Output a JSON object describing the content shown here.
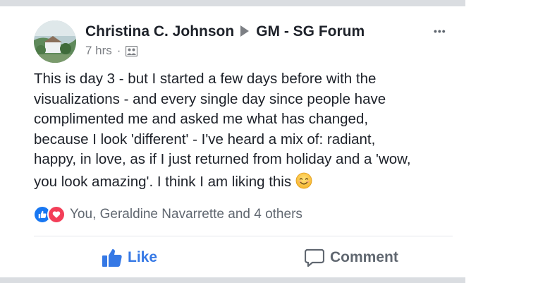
{
  "post": {
    "author": "Christina C. Johnson",
    "group": "GM - SG Forum",
    "time": "7 hrs",
    "visibility_icon": "group-icon",
    "more_label": "•••",
    "text_lines": [
      "This is day 3 - but I started a few days before with the",
      "visualizations - and every single day since people have",
      "complimented me and asked me what has changed,",
      "because I look 'different' - I've heard a mix of: radiant,",
      "happy, in love, as if I just returned from holiday and a 'wow,",
      "you look amazing'. I think I am liking this"
    ],
    "emoji": "smiling-face-icon"
  },
  "reactions": {
    "types": [
      "like-reaction-icon",
      "love-reaction-icon"
    ],
    "summary": "You, Geraldine Navarrette and 4 others"
  },
  "actions": {
    "like_label": "Like",
    "comment_label": "Comment"
  },
  "colors": {
    "like_blue": "#3578e5",
    "love_red": "#f33e58",
    "text_dark": "#1d2129",
    "text_grey": "#606770"
  }
}
